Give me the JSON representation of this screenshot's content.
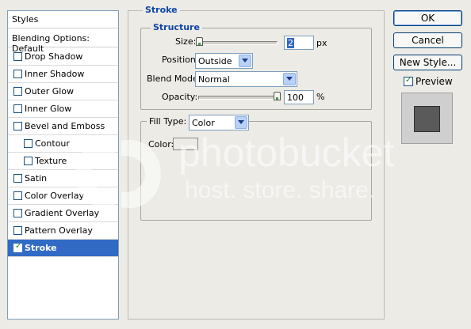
{
  "styles_list": {
    "header": "Styles",
    "blending": "Blending Options: Default",
    "items": [
      {
        "label": "Drop Shadow",
        "checked": false
      },
      {
        "label": "Inner Shadow",
        "checked": false
      },
      {
        "label": "Outer Glow",
        "checked": false
      },
      {
        "label": "Inner Glow",
        "checked": false
      },
      {
        "label": "Bevel and Emboss",
        "checked": false
      },
      {
        "label": "Contour",
        "checked": false
      },
      {
        "label": "Texture",
        "checked": false
      },
      {
        "label": "Satin",
        "checked": false
      },
      {
        "label": "Color Overlay",
        "checked": false
      },
      {
        "label": "Gradient Overlay",
        "checked": false
      },
      {
        "label": "Pattern Overlay",
        "checked": false
      },
      {
        "label": "Stroke",
        "checked": true
      }
    ]
  },
  "stroke": {
    "title": "Stroke",
    "structure": {
      "title": "Structure",
      "size_label": "Size:",
      "size_value": "2",
      "size_unit": "px",
      "position_label": "Position:",
      "position_value": "Outside",
      "blend_label": "Blend Mode:",
      "blend_value": "Normal",
      "opacity_label": "Opacity:",
      "opacity_value": "100",
      "opacity_unit": "%"
    },
    "fill": {
      "type_label": "Fill Type:",
      "type_value": "Color",
      "color_label": "Color:",
      "color_swatch": "#ecebe6"
    }
  },
  "buttons": {
    "ok": "OK",
    "cancel": "Cancel",
    "new_style": "New Style...",
    "preview_label": "Preview",
    "preview_checked": true
  },
  "watermark": {
    "line1": "photobucket",
    "line2": "host. store. share."
  },
  "colors": {
    "selection": "#316ac5",
    "accent_text": "#0f46a8"
  }
}
